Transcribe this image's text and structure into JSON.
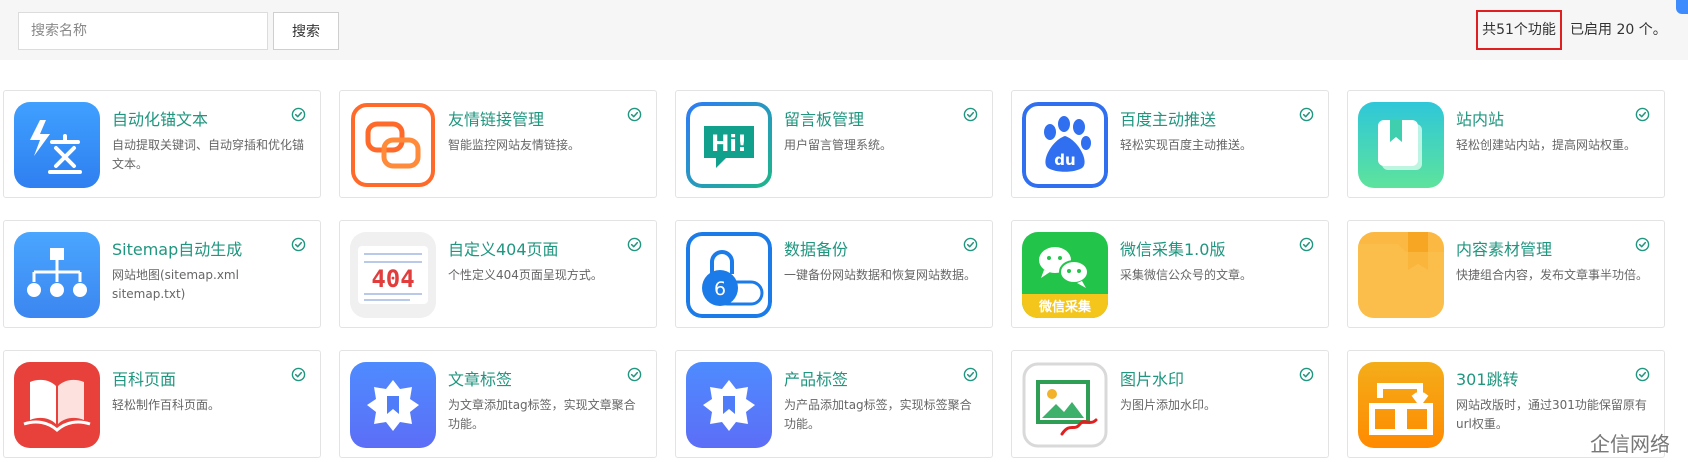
{
  "search": {
    "placeholder": "搜索名称",
    "button_label": "搜索"
  },
  "summary": {
    "total_label": "共51个功能",
    "enabled_label": "已启用 20 个。"
  },
  "watermark": "企信网络",
  "colors": {
    "accent": "#20967f",
    "highlight_border": "#e02020"
  },
  "features": [
    {
      "title": "自动化锚文本",
      "desc": "自动提取关键词、自动穿插和优化锚文本。",
      "icon": "translate-icon",
      "enabled": true
    },
    {
      "title": "友情链接管理",
      "desc": "智能监控网站友情链接。",
      "icon": "link-icon",
      "enabled": true
    },
    {
      "title": "留言板管理",
      "desc": "用户留言管理系统。",
      "icon": "message-icon",
      "enabled": true
    },
    {
      "title": "百度主动推送",
      "desc": "轻松实现百度主动推送。",
      "icon": "baidu-icon",
      "enabled": true
    },
    {
      "title": "站内站",
      "desc": "轻松创建站内站，提高网站权重。",
      "icon": "bookmark-icon",
      "enabled": true
    },
    {
      "title": "Sitemap自动生成",
      "desc": "网站地图(sitemap.xml sitemap.txt)",
      "icon": "sitemap-icon",
      "enabled": true
    },
    {
      "title": "自定义404页面",
      "desc": "个性定义404页面呈现方式。",
      "icon": "error-404-icon",
      "enabled": true
    },
    {
      "title": "数据备份",
      "desc": "一键备份网站数据和恢复网站数据。",
      "icon": "backup-icon",
      "enabled": true
    },
    {
      "title": "微信采集1.0版",
      "desc": "采集微信公众号的文章。",
      "icon": "wechat-icon",
      "icon_text": "微信采集",
      "enabled": true
    },
    {
      "title": "内容素材管理",
      "desc": "快捷组合内容，发布文章事半功倍。",
      "icon": "folder-icon",
      "enabled": true
    },
    {
      "title": "百科页面",
      "desc": "轻松制作百科页面。",
      "icon": "book-icon",
      "enabled": true
    },
    {
      "title": "文章标签",
      "desc": "为文章添加tag标签，实现文章聚合功能。",
      "icon": "tag-badge-icon",
      "enabled": true
    },
    {
      "title": "产品标签",
      "desc": "为产品添加tag标签，实现标签聚合功能。",
      "icon": "tag-badge-icon",
      "enabled": true
    },
    {
      "title": "图片水印",
      "desc": "为图片添加水印。",
      "icon": "image-watermark-icon",
      "enabled": true
    },
    {
      "title": "301跳转",
      "desc": "网站改版时，通过301功能保留原有url权重。",
      "icon": "redirect-icon",
      "enabled": true
    }
  ]
}
